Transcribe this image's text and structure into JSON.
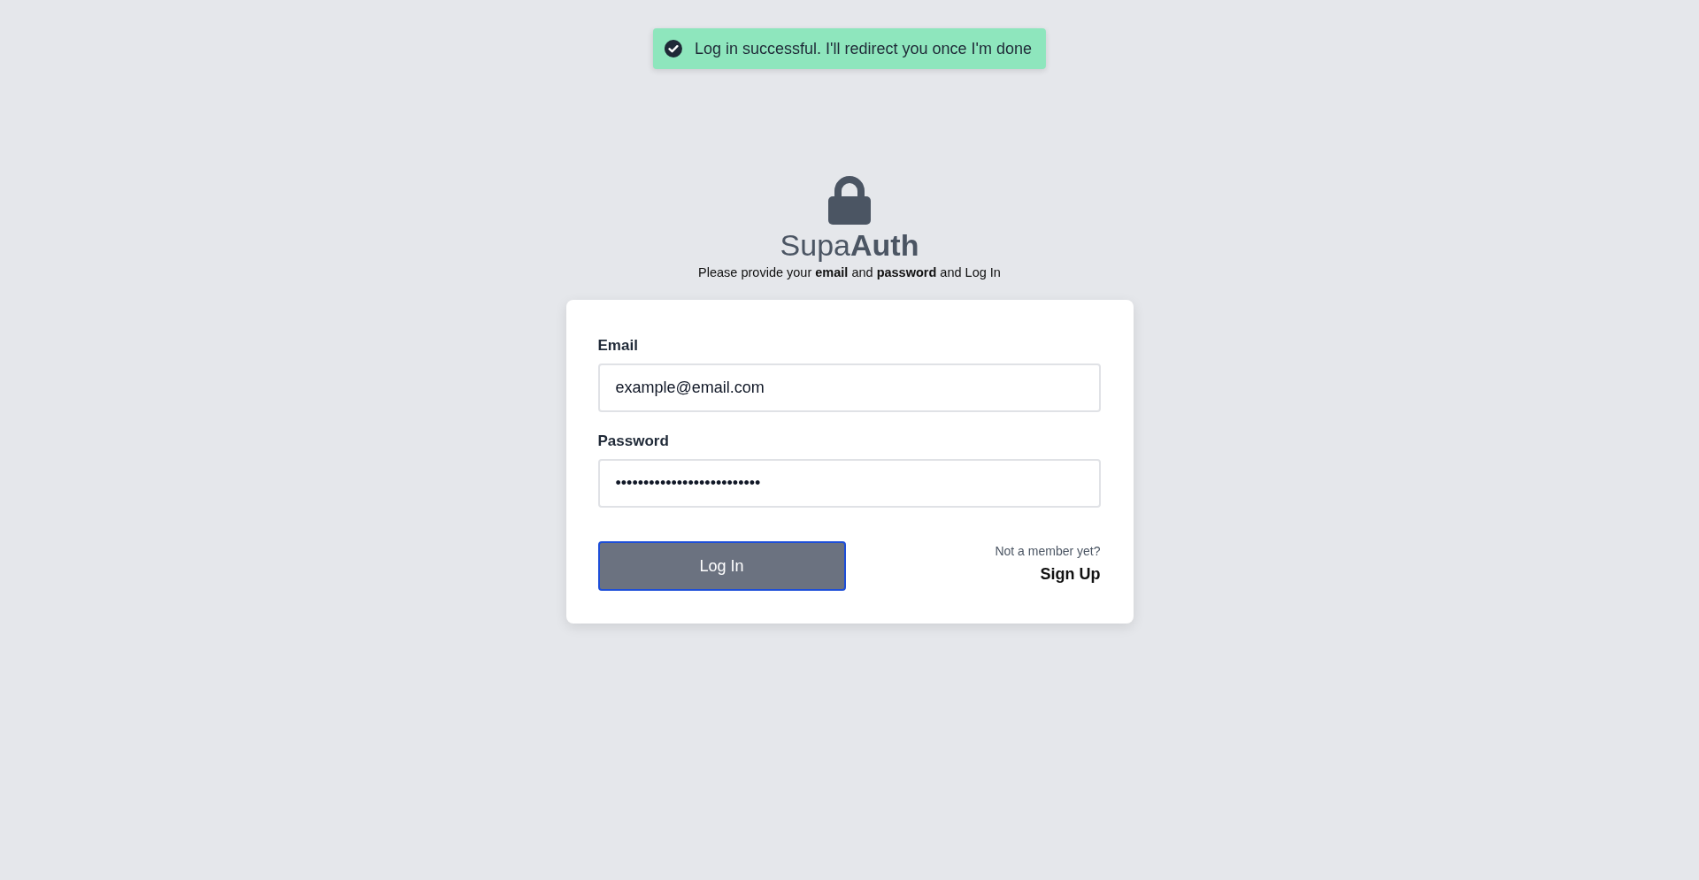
{
  "toast": {
    "kind": "success",
    "message": "Log in successful. I'll redirect you once I'm done"
  },
  "header": {
    "brand": "Supa**Auth**",
    "tagline": "Please provide your **email** and **password** and Log In"
  },
  "login_form": {
    "fields": [
      {
        "kind": "email",
        "label": "Email",
        "value": "example@email.com"
      },
      {
        "kind": "password",
        "label": "Password",
        "value": "••••••••••••••••••••••••••"
      }
    ],
    "submit": {
      "label": "Log In",
      "focused": true
    },
    "signup": {
      "prompt": "Not a member yet?",
      "link": "Sign Up"
    }
  }
}
